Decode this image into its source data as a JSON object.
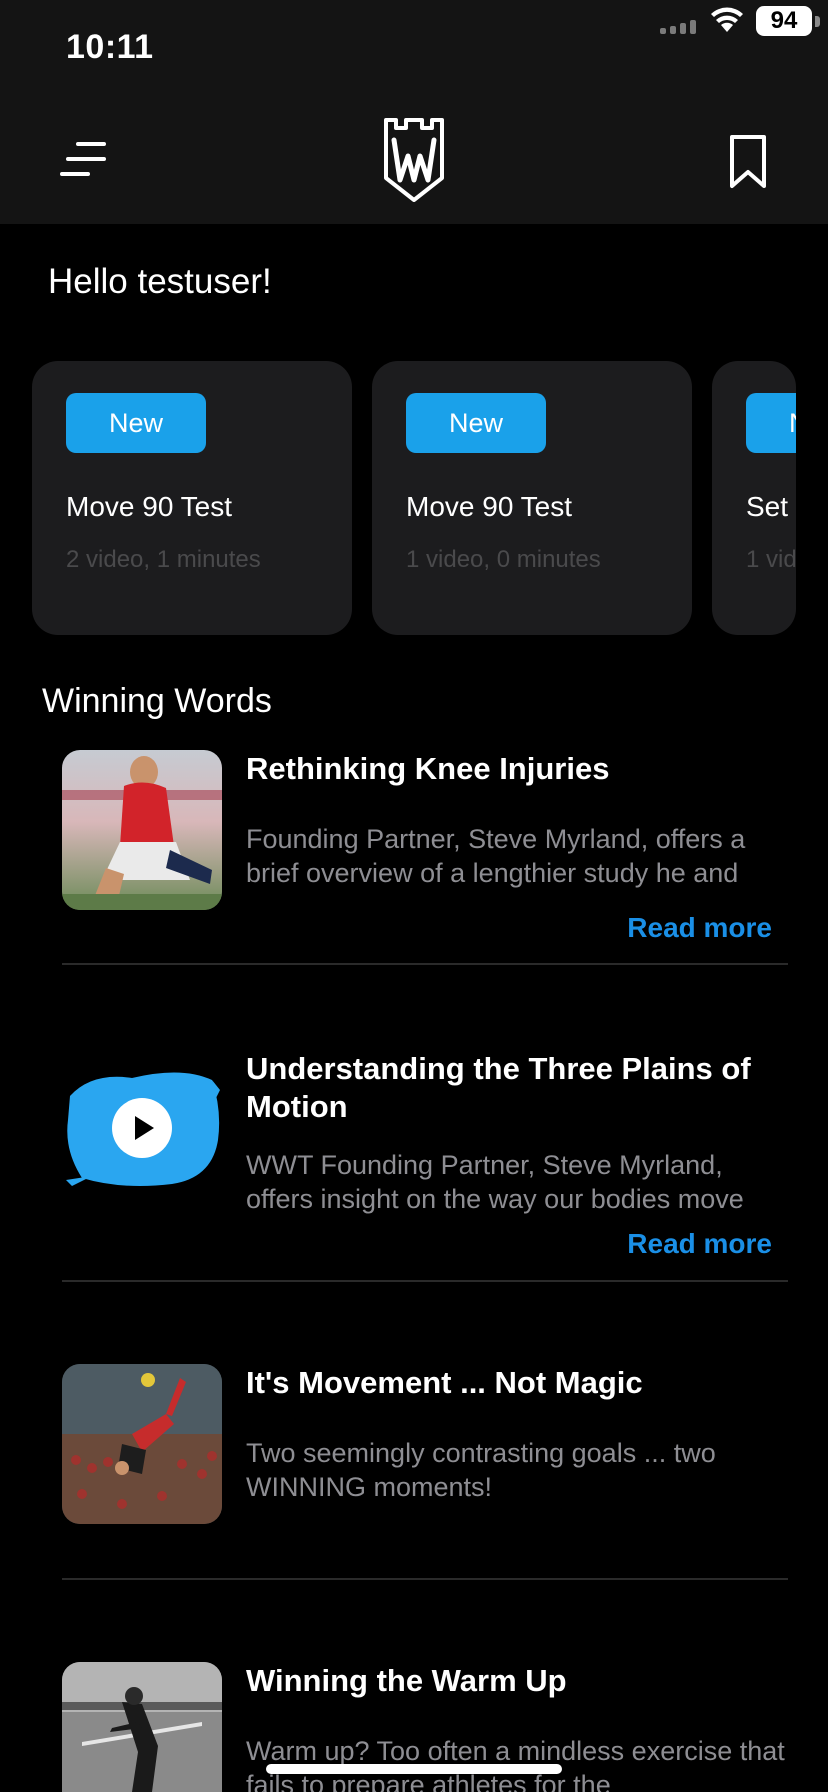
{
  "status_bar": {
    "time": "10:11",
    "battery": "94"
  },
  "nav": {
    "menu_icon": "menu-icon",
    "logo_icon": "wwt-logo-icon",
    "bookmark_icon": "bookmark-icon"
  },
  "greeting": "Hello testuser!",
  "workouts": [
    {
      "badge": "New",
      "title": "Move 90 Test",
      "meta": "2 video, 1 minutes"
    },
    {
      "badge": "New",
      "title": "Move 90 Test",
      "meta": "1 video, 0 minutes"
    },
    {
      "badge": "New",
      "title": "Set",
      "meta": "1 vid"
    }
  ],
  "section_title": "Winning Words",
  "articles": [
    {
      "title": "Rethinking Knee Injuries",
      "description": "Founding Partner, Steve Myrland, offers a brief overview of a lengthier study he and",
      "read_more": "Read more"
    },
    {
      "title": "Understanding the Three Plains of Motion",
      "description": "WWT Founding Partner, Steve Myrland, offers insight on the way our bodies move",
      "read_more": "Read more"
    },
    {
      "title": "It's Movement ... Not Magic",
      "description": "Two seemingly contrasting goals ... two WINNING moments!"
    },
    {
      "title": "Winning the Warm Up",
      "description": "Warm up? Too often a mindless exercise that fails to prepare athletes for the"
    }
  ],
  "colors": {
    "accent": "#1aa1ea",
    "link": "#1a8fe6",
    "card_bg": "#1c1c1e",
    "header_bg": "#141414"
  }
}
